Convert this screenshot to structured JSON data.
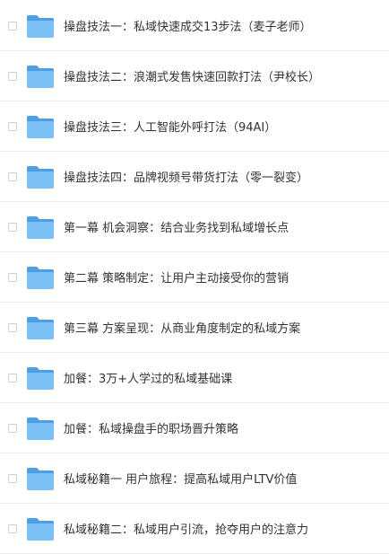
{
  "icon": "folder-icon",
  "colors": {
    "folder_body": "#66b3f0",
    "folder_tab": "#4e9fe3",
    "folder_front": "#7cc1f6",
    "text": "#333333",
    "divider": "#ececec"
  },
  "items": [
    {
      "label": "操盘技法一：私域快速成交13步法（麦子老师）"
    },
    {
      "label": "操盘技法二：浪潮式发售快速回款打法（尹校长）"
    },
    {
      "label": "操盘技法三：人工智能外呼打法（94AI）"
    },
    {
      "label": "操盘技法四：品牌视频号带货打法（零一裂变）"
    },
    {
      "label": "第一幕 机会洞察：结合业务找到私域增长点"
    },
    {
      "label": "第二幕 策略制定：让用户主动接受你的营销"
    },
    {
      "label": "第三幕 方案呈现：从商业角度制定的私域方案"
    },
    {
      "label": "加餐：3万+人学过的私域基础课"
    },
    {
      "label": "加餐：私域操盘手的职场晋升策略"
    },
    {
      "label": "私域秘籍一 用户旅程：提高私域用户LTV价值"
    },
    {
      "label": "私域秘籍二：私域用户引流，抢夺用户的注意力"
    }
  ]
}
